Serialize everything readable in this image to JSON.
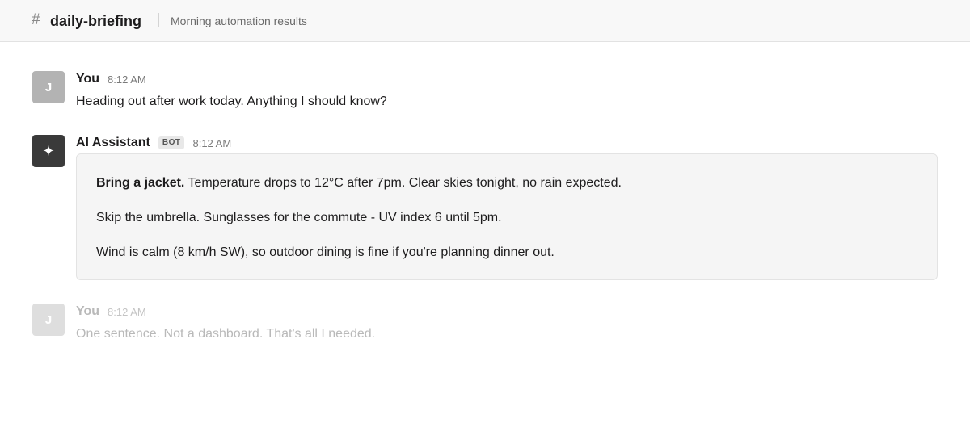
{
  "channel": {
    "hash": "#",
    "name": "daily-briefing",
    "topic": "Morning automation results"
  },
  "messages": [
    {
      "avatar_initial": "J",
      "author": "You",
      "time": "8:12 AM",
      "text": "Heading out after work today. Anything I should know?"
    },
    {
      "avatar_icon": "sparkle-icon",
      "avatar_glyph": "✦",
      "author": "AI Assistant",
      "badge": "BOT",
      "time": "8:12 AM",
      "lines": [
        {
          "bold": "Bring a jacket.",
          "text": " Temperature drops to 12°C after 7pm. Clear skies tonight, no rain expected."
        },
        {
          "text": "Skip the umbrella. Sunglasses for the commute - UV index 6 until 5pm."
        },
        {
          "text": "Wind is calm (8 km/h SW), so outdoor dining is fine if you're planning dinner out."
        }
      ]
    },
    {
      "avatar_initial": "J",
      "author": "You",
      "time": "8:12 AM",
      "text": "One sentence. Not a dashboard. That's all I needed."
    }
  ]
}
